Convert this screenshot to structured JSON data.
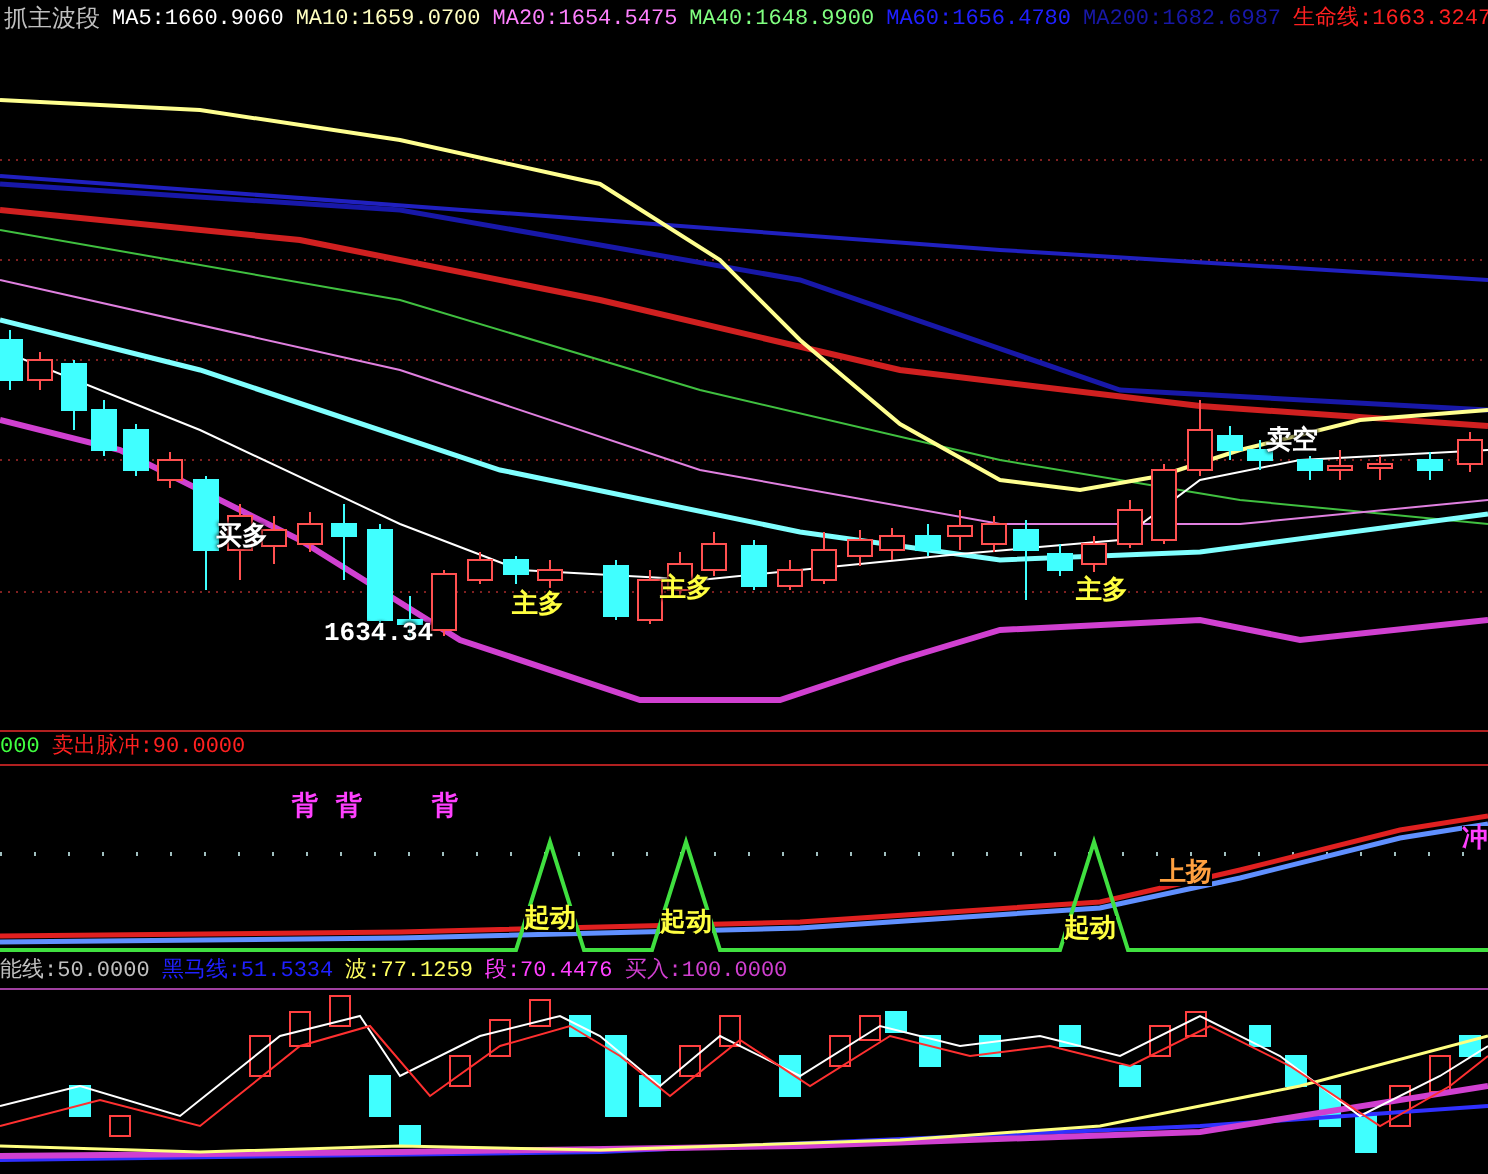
{
  "main_header": {
    "title": "抓主波段",
    "indicators": [
      {
        "label": "MA5:1660.9060",
        "color": "#ffffff"
      },
      {
        "label": "MA10:1659.0700",
        "color": "#ffffc0"
      },
      {
        "label": "MA20:1654.5475",
        "color": "#ff80ff"
      },
      {
        "label": "MA40:1648.9900",
        "color": "#80ff80"
      },
      {
        "label": "MA60:1656.4780",
        "color": "#2020ff"
      },
      {
        "label": "MA200:1682.6987",
        "color": "#1818a8"
      },
      {
        "label": "生命线:1663.3247",
        "color": "#ff2020"
      }
    ]
  },
  "main_chart": {
    "annotations": [
      {
        "text": "买多",
        "color": "#ffffff"
      },
      {
        "text": "主多",
        "color": "#ffff40"
      },
      {
        "text": "主多",
        "color": "#ffff40"
      },
      {
        "text": "主多",
        "color": "#ffff40"
      },
      {
        "text": "卖空",
        "color": "#ffffff"
      },
      {
        "text": "1634.34",
        "color": "#ffffff"
      }
    ]
  },
  "signal_header": {
    "indicators": [
      {
        "label": "000",
        "color": "#40ff40"
      },
      {
        "label": "卖出脉冲:90.0000",
        "color": "#ff2020"
      }
    ]
  },
  "signal_chart": {
    "annotations": [
      {
        "text": "背",
        "color": "#ff40ff"
      },
      {
        "text": "背",
        "color": "#ff40ff"
      },
      {
        "text": "背",
        "color": "#ff40ff"
      },
      {
        "text": "起动",
        "color": "#ffff40"
      },
      {
        "text": "起动",
        "color": "#ffff40"
      },
      {
        "text": "起动",
        "color": "#ffff40"
      },
      {
        "text": "上扬",
        "color": "#ffa040"
      },
      {
        "text": "冲",
        "color": "#ff40ff"
      }
    ]
  },
  "oscillator_header": {
    "indicators": [
      {
        "label": "能线:50.0000",
        "color": "#c0c0c0"
      },
      {
        "label": "黑马线:51.5334",
        "color": "#2020ff"
      },
      {
        "label": "波:77.1259",
        "color": "#ffff60"
      },
      {
        "label": "段:70.4476",
        "color": "#ff40ff"
      },
      {
        "label": "买入:100.0000",
        "color": "#d040d0"
      }
    ]
  }
}
